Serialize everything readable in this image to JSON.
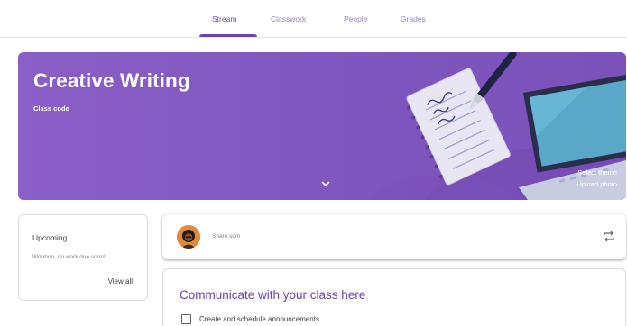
{
  "tabs": [
    {
      "label": "Stream",
      "active": true
    },
    {
      "label": "Classwork",
      "active": false
    },
    {
      "label": "People",
      "active": false
    },
    {
      "label": "Grades",
      "active": false
    }
  ],
  "banner": {
    "title": "Creative Writing",
    "subtitle": "Class code",
    "select_theme": "Select theme",
    "upload_photo": "Upload photo",
    "color": "#8a5fc7"
  },
  "upcoming": {
    "title": "Upcoming",
    "text": "Woohoo, no work due soon!",
    "view_all": "View all"
  },
  "share": {
    "placeholder": "Share som",
    "icon": "repost-icon"
  },
  "communicate": {
    "title": "Communicate with your class here",
    "checkbox_label": "Create and schedule announcements"
  },
  "colors": {
    "accent": "#6a43b5",
    "tab_active": "#6f4fa8"
  }
}
